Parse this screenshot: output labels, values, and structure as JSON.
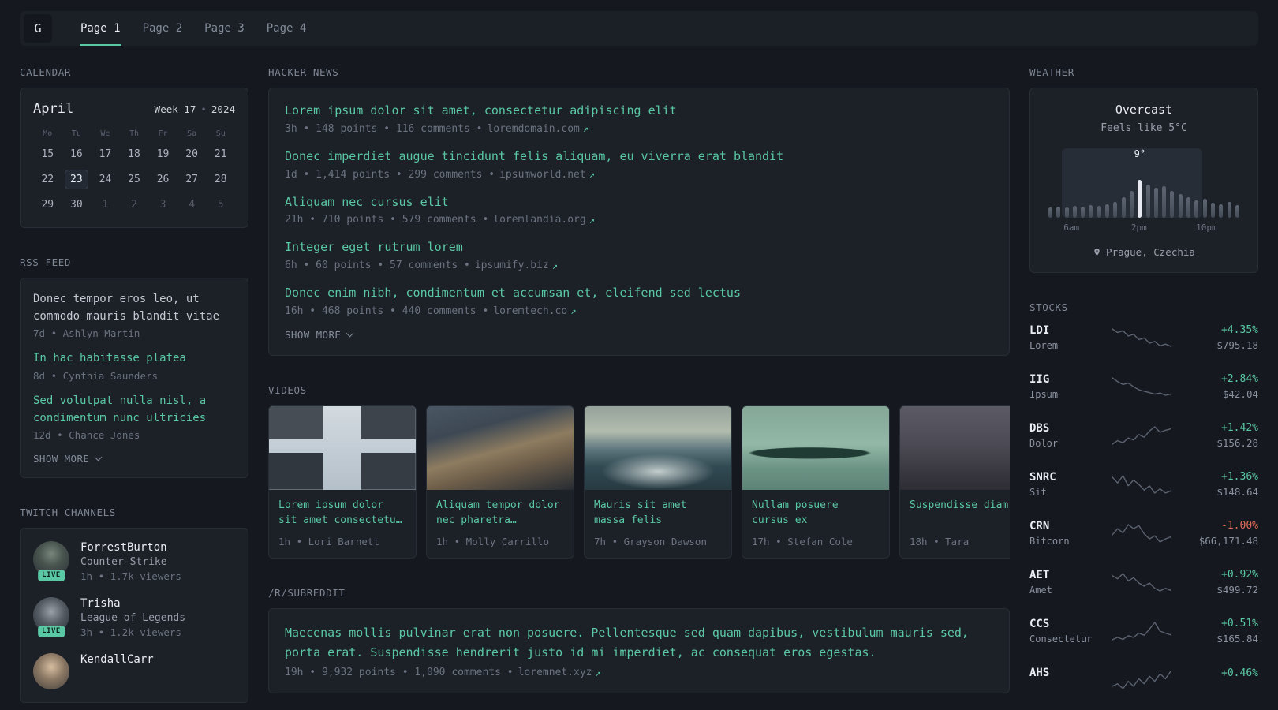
{
  "colors": {
    "accent": "#5bc8a5",
    "negative": "#e0695a"
  },
  "icons": {
    "external": "↗"
  },
  "topbar": {
    "logo": "G",
    "tabs": [
      {
        "label": "Page 1"
      },
      {
        "label": "Page 2"
      },
      {
        "label": "Page 3"
      },
      {
        "label": "Page 4"
      }
    ]
  },
  "calendar": {
    "header": "CALENDAR",
    "month": "April",
    "week": "Week 17",
    "separator": "•",
    "year": "2024",
    "weekdays": [
      "Mo",
      "Tu",
      "We",
      "Th",
      "Fr",
      "Sa",
      "Su"
    ],
    "days": [
      "15",
      "16",
      "17",
      "18",
      "19",
      "20",
      "21",
      "22",
      "23",
      "24",
      "25",
      "26",
      "27",
      "28",
      "29",
      "30",
      "1",
      "2",
      "3",
      "4",
      "5"
    ],
    "selected_day": "23"
  },
  "rss": {
    "header": "RSS FEED",
    "items": [
      {
        "title": "Donec tempor eros leo, ut commodo mauris blandit vitae",
        "meta": "7d • Ashlyn Martin"
      },
      {
        "title": "In hac habitasse platea",
        "meta": "8d • Cynthia Saunders"
      },
      {
        "title": "Sed volutpat nulla nisl, a condimentum nunc ultricies",
        "meta": "12d • Chance Jones"
      }
    ],
    "show_more": "SHOW MORE"
  },
  "twitch": {
    "header": "TWITCH CHANNELS",
    "items": [
      {
        "name": "ForrestBurton",
        "game": "Counter-Strike",
        "meta": "1h • 1.7k viewers",
        "badge": "LIVE"
      },
      {
        "name": "Trisha",
        "game": "League of Legends",
        "meta": "3h • 1.2k viewers",
        "badge": "LIVE"
      },
      {
        "name": "KendallCarr",
        "game": "",
        "meta": "",
        "badge": ""
      }
    ]
  },
  "hackernews": {
    "header": "HACKER NEWS",
    "items": [
      {
        "title": "Lorem ipsum dolor sit amet, consectetur adipiscing elit",
        "meta": "3h • 148 points • 116 comments •",
        "domain": "loremdomain.com"
      },
      {
        "title": "Donec imperdiet augue tincidunt felis aliquam, eu viverra erat blandit",
        "meta": "1d • 1,414 points • 299 comments •",
        "domain": "ipsumworld.net"
      },
      {
        "title": "Aliquam nec cursus elit",
        "meta": "21h • 710 points • 579 comments •",
        "domain": "loremlandia.org"
      },
      {
        "title": "Integer eget rutrum lorem",
        "meta": "6h • 60 points • 57 comments •",
        "domain": "ipsumify.biz"
      },
      {
        "title": "Donec enim nibh, condimentum et accumsan et, eleifend sed lectus",
        "meta": "16h • 468 points • 440 comments •",
        "domain": "loremtech.co"
      }
    ],
    "show_more": "SHOW MORE"
  },
  "videos": {
    "header": "VIDEOS",
    "items": [
      {
        "title": "Lorem ipsum dolor sit amet consectetu…",
        "meta": "1h • Lori Barnett"
      },
      {
        "title": "Aliquam tempor dolor nec pharetra…",
        "meta": "1h • Molly Carrillo"
      },
      {
        "title": "Mauris sit amet massa felis",
        "meta": "7h • Grayson Dawson"
      },
      {
        "title": "Nullam posuere cursus ex",
        "meta": "17h • Stefan Cole"
      },
      {
        "title": "Suspendisse diam",
        "meta": "18h • Tara"
      }
    ]
  },
  "subreddit": {
    "header": "/R/SUBREDDIT",
    "items": [
      {
        "title": "Maecenas mollis pulvinar erat non posuere. Pellentesque sed quam dapibus, vestibulum mauris sed, porta erat. Suspendisse hendrerit justo id mi imperdiet, ac consequat eros egestas.",
        "meta": "19h • 9,932 points • 1,090 comments •",
        "domain": "loremnet.xyz"
      }
    ]
  },
  "weather": {
    "header": "WEATHER",
    "condition": "Overcast",
    "feels_like": "Feels like 5°C",
    "temp_label": "9°",
    "location": "Prague, Czechia",
    "chart": {
      "bars": [
        13,
        14,
        13,
        15,
        14,
        16,
        15,
        17,
        20,
        26,
        34,
        48,
        42,
        38,
        40,
        34,
        30,
        26,
        22,
        24,
        19,
        17,
        20,
        16
      ],
      "highlight_index": 11,
      "daylight": [
        0.08,
        0.72
      ],
      "time_labels": [
        {
          "text": "6am",
          "pos": 0.13
        },
        {
          "text": "2pm",
          "pos": 0.475
        },
        {
          "text": "10pm",
          "pos": 0.82
        }
      ]
    }
  },
  "stocks": {
    "header": "STOCKS",
    "items": [
      {
        "symbol": "LDI",
        "name": "Lorem",
        "change": "+4.35%",
        "price": "$795.18",
        "spark": [
          8,
          7.2,
          7.6,
          6.4,
          6.8,
          5.6,
          6,
          4.8,
          5.2,
          4.2,
          4.6,
          4.1
        ]
      },
      {
        "symbol": "IIG",
        "name": "Ipsum",
        "change": "+2.84%",
        "price": "$42.04",
        "spark": [
          8.6,
          7.6,
          6.8,
          7.2,
          6.2,
          5.4,
          5,
          4.6,
          4.2,
          4.5,
          3.9,
          4.2
        ]
      },
      {
        "symbol": "DBS",
        "name": "Dolor",
        "change": "+1.42%",
        "price": "$156.28",
        "spark": [
          3.2,
          4.2,
          3.6,
          5,
          4.4,
          6,
          5.2,
          7,
          8.2,
          6.6,
          7.2,
          7.6
        ]
      },
      {
        "symbol": "SNRC",
        "name": "Sit",
        "change": "+1.36%",
        "price": "$148.64",
        "spark": [
          6.4,
          5.6,
          6.6,
          5.2,
          6,
          5.4,
          4.6,
          5.2,
          4.2,
          4.8,
          4.2,
          4.5
        ]
      },
      {
        "symbol": "CRN",
        "name": "Bitcorn",
        "change": "-1.00%",
        "price": "$66,171.48",
        "spark": [
          5,
          6.2,
          5.4,
          7,
          6.2,
          6.8,
          5.2,
          4.2,
          4.8,
          3.6,
          4.2,
          4.6
        ]
      },
      {
        "symbol": "AET",
        "name": "Amet",
        "change": "+0.92%",
        "price": "$499.72",
        "spark": [
          7,
          6.4,
          7.4,
          6,
          6.6,
          5.6,
          5,
          5.6,
          4.6,
          4.1,
          4.6,
          4.2
        ]
      },
      {
        "symbol": "CCS",
        "name": "Consectetur",
        "change": "+0.51%",
        "price": "$165.84",
        "spark": [
          4,
          4.6,
          4.1,
          5,
          4.6,
          5.6,
          5.1,
          6.6,
          8.2,
          6.1,
          5.6,
          5.2
        ]
      },
      {
        "symbol": "AHS",
        "name": "",
        "change": "+0.46%",
        "price": "",
        "spark": [
          5,
          5.2,
          4.8,
          5.4,
          5,
          5.6,
          5.2,
          5.8,
          5.4,
          6,
          5.6,
          6.2
        ]
      }
    ]
  }
}
